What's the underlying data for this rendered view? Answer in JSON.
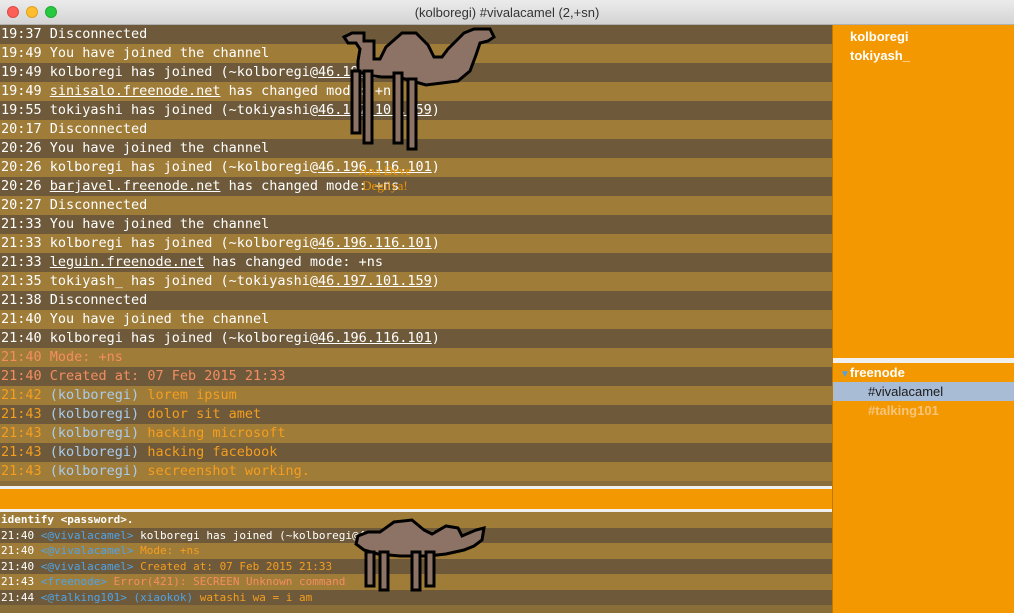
{
  "window": {
    "title": "(kolboregi) #vivalacamel (2,+sn)"
  },
  "chat_lines": [
    {
      "time": "19:37",
      "parts": [
        {
          "t": "Disconnected"
        }
      ],
      "kind": "plain"
    },
    {
      "time": "19:49",
      "parts": [
        {
          "t": "You have joined the channel"
        }
      ],
      "kind": "plain"
    },
    {
      "time": "19:49",
      "parts": [
        {
          "t": "kolboregi has joined (~kolboregi@"
        },
        {
          "t": "46.196.116.101",
          "u": true
        },
        {
          "t": ")"
        }
      ],
      "kind": "plain"
    },
    {
      "time": "19:49",
      "parts": [
        {
          "t": "sinisalo.freenode.net",
          "u": true
        },
        {
          "t": " has changed mode: +ns"
        }
      ],
      "kind": "plain"
    },
    {
      "time": "19:55",
      "parts": [
        {
          "t": "tokiyashi has joined (~tokiyashi@"
        },
        {
          "t": "46.197.101.159",
          "u": true
        },
        {
          "t": ")"
        }
      ],
      "kind": "plain"
    },
    {
      "time": "20:17",
      "parts": [
        {
          "t": "Disconnected"
        }
      ],
      "kind": "plain"
    },
    {
      "time": "20:26",
      "parts": [
        {
          "t": "You have joined the channel"
        }
      ],
      "kind": "plain"
    },
    {
      "time": "20:26",
      "parts": [
        {
          "t": "kolboregi has joined (~kolboregi@"
        },
        {
          "t": "46.196.116.101",
          "u": true
        },
        {
          "t": ")"
        }
      ],
      "kind": "plain"
    },
    {
      "time": "20:26",
      "parts": [
        {
          "t": "barjavel.freenode.net",
          "u": true
        },
        {
          "t": " has changed mode: +ns"
        }
      ],
      "kind": "plain"
    },
    {
      "time": "20:27",
      "parts": [
        {
          "t": "Disconnected"
        }
      ],
      "kind": "plain"
    },
    {
      "time": "21:33",
      "parts": [
        {
          "t": "You have joined the channel"
        }
      ],
      "kind": "plain"
    },
    {
      "time": "21:33",
      "parts": [
        {
          "t": "kolboregi has joined (~kolboregi@"
        },
        {
          "t": "46.196.116.101",
          "u": true
        },
        {
          "t": ")"
        }
      ],
      "kind": "plain"
    },
    {
      "time": "21:33",
      "parts": [
        {
          "t": "leguin.freenode.net",
          "u": true
        },
        {
          "t": " has changed mode: +ns"
        }
      ],
      "kind": "plain"
    },
    {
      "time": "21:35",
      "parts": [
        {
          "t": "tokiyash_ has joined (~tokiyashi@"
        },
        {
          "t": "46.197.101.159",
          "u": true
        },
        {
          "t": ")"
        }
      ],
      "kind": "plain"
    },
    {
      "time": "21:38",
      "parts": [
        {
          "t": "Disconnected"
        }
      ],
      "kind": "plain"
    },
    {
      "time": "21:40",
      "parts": [
        {
          "t": "You have joined the channel"
        }
      ],
      "kind": "plain"
    },
    {
      "time": "21:40",
      "parts": [
        {
          "t": "kolboregi has joined (~kolboregi@"
        },
        {
          "t": "46.196.116.101",
          "u": true
        },
        {
          "t": ")"
        }
      ],
      "kind": "plain"
    },
    {
      "time": "21:40",
      "parts": [
        {
          "t": "Mode: +ns"
        }
      ],
      "kind": "mode"
    },
    {
      "time": "21:40",
      "parts": [
        {
          "t": "Created at: 07 Feb 2015 21:33"
        }
      ],
      "kind": "mode"
    },
    {
      "time": "21:42",
      "nick": "(kolboregi)",
      "parts": [
        {
          "t": "lorem ipsum"
        }
      ],
      "kind": "msg"
    },
    {
      "time": "21:43",
      "nick": "(kolboregi)",
      "parts": [
        {
          "t": "dolor sit amet"
        }
      ],
      "kind": "msg"
    },
    {
      "time": "21:43",
      "nick": "(kolboregi)",
      "parts": [
        {
          "t": "hacking microsoft"
        }
      ],
      "kind": "msg"
    },
    {
      "time": "21:43",
      "nick": "(kolboregi)",
      "parts": [
        {
          "t": "hacking facebook"
        }
      ],
      "kind": "msg"
    },
    {
      "time": "21:43",
      "nick": "(kolboregi)",
      "parts": [
        {
          "t": "secreenshot working."
        }
      ],
      "kind": "msg"
    }
  ],
  "camel_caption": {
    "line1": "Ana Deve",
    "line2": "Degilya!"
  },
  "input": {
    "value": ""
  },
  "log_lines": [
    {
      "time": "",
      "src": "",
      "text": "identify <password>.",
      "cls": "plain"
    },
    {
      "time": "21:40",
      "src": "<@vivalacamel>",
      "text": "kolboregi has joined (~kolboregi@46.196.116.101)",
      "cls": "plain"
    },
    {
      "time": "21:40",
      "src": "<@vivalacamel>",
      "text": "Mode: +ns",
      "cls": "bmode"
    },
    {
      "time": "21:40",
      "src": "<@vivalacamel>",
      "text": "Created at: 07 Feb 2015 21:33",
      "cls": "bmode"
    },
    {
      "time": "21:43",
      "src": "<freenode>",
      "text": "Error(421): SECREEN Unknown command",
      "cls": "berr"
    },
    {
      "time": "21:44",
      "src": "<@talking101> (xiaokok)",
      "text": "watashi wa = i am",
      "cls": "bmode"
    }
  ],
  "users": [
    "kolboregi",
    "tokiyash_"
  ],
  "servers": [
    {
      "name": "freenode",
      "channels": [
        {
          "name": "#vivalacamel",
          "selected": true
        },
        {
          "name": "#talking101",
          "dim": true
        }
      ]
    }
  ],
  "colors": {
    "accent": "#f39800",
    "nick": "#a8ccf0",
    "message": "#f59e1e",
    "mode": "#f48d60",
    "selection": "#a9bcd6"
  }
}
